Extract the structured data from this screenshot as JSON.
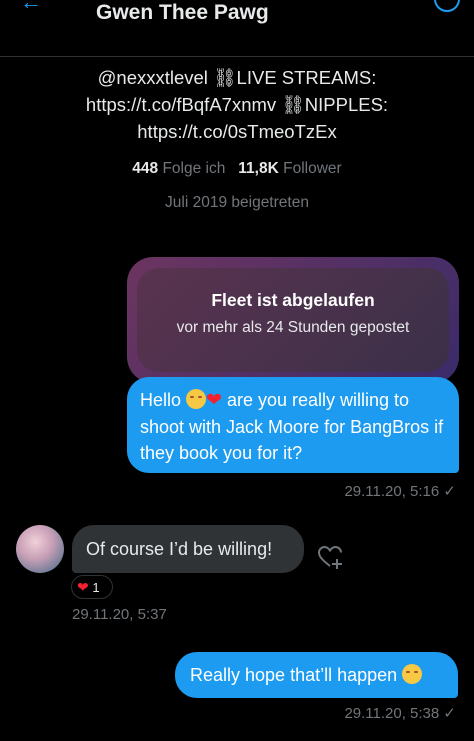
{
  "header": {
    "title": "Gwen Thee Pawg"
  },
  "profile": {
    "bio_lines": [
      "@nexxxtlevel ⛓LIVE STREAMS:",
      "https://t.co/fBqfA7xnmv ⛓NIPPLES:",
      "https://t.co/0sTmeoTzEx"
    ],
    "following_count": "448",
    "following_label": "Folge ich",
    "followers_count": "11,8K",
    "followers_label": "Follower",
    "joined": "Juli 2019 beigetreten"
  },
  "fleet": {
    "title": "Fleet ist abgelaufen",
    "subtitle": "vor mehr als 24 Stunden gepostet"
  },
  "messages": [
    {
      "direction": "outgoing",
      "text_start": "Hello",
      "emojis": [
        "smiling-face",
        "red-heart"
      ],
      "text_rest": "are you really willing to shoot with Jack Moore for BangBros if they book you for it?",
      "time": "29.11.20, 5:16",
      "status": "✓"
    },
    {
      "direction": "incoming",
      "text": "Of course I’d be willing!",
      "reaction_count": "1",
      "reaction_icon": "red-heart",
      "time": "29.11.20, 5:37"
    },
    {
      "direction": "outgoing",
      "text": "Really hope that’ll happen",
      "emojis": [
        "smiling-face"
      ],
      "time": "29.11.20, 5:38",
      "status": "✓"
    }
  ],
  "colors": {
    "accent": "#1d9bf0",
    "background": "#000000",
    "incoming_bubble": "#2f3336",
    "muted_text": "#71767b"
  }
}
